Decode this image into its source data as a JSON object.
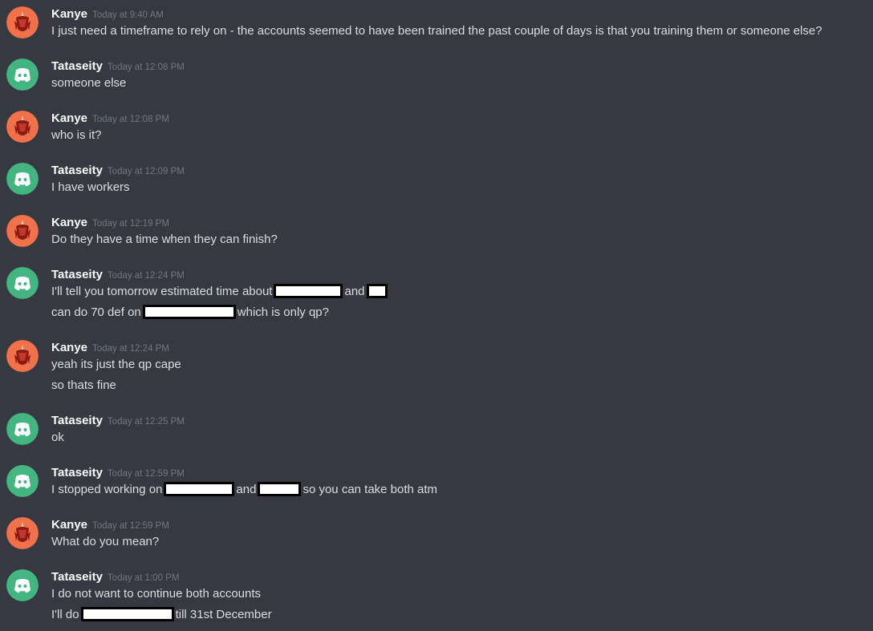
{
  "colors": {
    "background": "#36393f",
    "username": "#ffffff",
    "timestamp": "#72767d",
    "text": "#dcddde",
    "kanye_avatar": "#f0714a",
    "tataseity_avatar": "#43b581",
    "redaction_fill": "#ffffff",
    "redaction_border": "#000000"
  },
  "users": {
    "kanye": {
      "name": "Kanye",
      "avatar_icon": "kanye-avatar-icon"
    },
    "tataseity": {
      "name": "Tataseity",
      "avatar_icon": "discord-logo-icon"
    }
  },
  "messages": [
    {
      "user": "Kanye",
      "time": "Today at 9:40 AM",
      "lines": [
        {
          "text": "I just need a timeframe to rely on - the accounts seemed to have been trained the past couple of days is that you training them or someone else?"
        }
      ]
    },
    {
      "user": "Tataseity",
      "time": "Today at 12:08 PM",
      "lines": [
        {
          "text": "someone else"
        }
      ]
    },
    {
      "user": "Kanye",
      "time": "Today at 12:08 PM",
      "lines": [
        {
          "text": "who is it?"
        }
      ]
    },
    {
      "user": "Tataseity",
      "time": "Today at 12:09 PM",
      "lines": [
        {
          "text": "I have workers"
        }
      ]
    },
    {
      "user": "Kanye",
      "time": "Today at 12:19 PM",
      "lines": [
        {
          "text": "Do they have a time when they can finish?"
        }
      ]
    },
    {
      "user": "Tataseity",
      "time": "Today at 12:24 PM",
      "lines": [
        {
          "a": "I'll tell you tomorrow estimated time about",
          "b": "and"
        },
        {
          "a": "can do 70 def on",
          "b": "which is only qp?"
        }
      ]
    },
    {
      "user": "Kanye",
      "time": "Today at 12:24 PM",
      "lines": [
        {
          "text": "yeah its just the qp cape"
        },
        {
          "text": "so thats fine"
        }
      ]
    },
    {
      "user": "Tataseity",
      "time": "Today at 12:25 PM",
      "lines": [
        {
          "text": "ok"
        }
      ]
    },
    {
      "user": "Tataseity",
      "time": "Today at 12:59 PM",
      "lines": [
        {
          "a": "I stopped working on",
          "b": "and",
          "c": "so you can take both atm"
        }
      ]
    },
    {
      "user": "Kanye",
      "time": "Today at 12:59 PM",
      "lines": [
        {
          "text": "What do you mean?"
        }
      ]
    },
    {
      "user": "Tataseity",
      "time": "Today at 1:00 PM",
      "lines": [
        {
          "text": "I do not want to continue both accounts"
        },
        {
          "a": "I'll do",
          "b": "till 31st December"
        }
      ]
    }
  ]
}
